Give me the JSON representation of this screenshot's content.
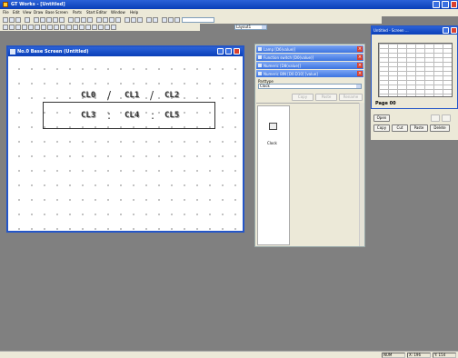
{
  "app": {
    "title": "GT Works - [Untitled]"
  },
  "menu": [
    "File",
    "Edit",
    "View",
    "Draw",
    "Base Screen",
    "Parts",
    "Start Editor",
    "Window",
    "Help"
  ],
  "toolbar": {
    "layer_value": "Layout1"
  },
  "base_window": {
    "title": "No.0 Base Screen (Untitled)",
    "clock_fields": {
      "cl0": "CL0",
      "cl1": "CL1",
      "cl2": "CL2",
      "cl3": "CL3",
      "cl4": "CL4",
      "cl5": "CL5"
    },
    "date_sep": "/",
    "time_sep": ":"
  },
  "parts_panel": {
    "processes": [
      {
        "label": "Lamp [D6(value)]"
      },
      {
        "label": "Function switch [D0(value)]"
      },
      {
        "label": "Numeric [D8(value)]"
      },
      {
        "label": "Numeric BIN [D0.D10] [value]"
      }
    ],
    "parttype_label": "Parttype",
    "parttype_value": "Clock",
    "buttons": {
      "copy": "Copy",
      "paste": "Paste",
      "rename": "Rename"
    },
    "part_item": "Clock"
  },
  "screen_window": {
    "title": "Untitled - Screen ...",
    "page_label": "Page 00",
    "buttons": {
      "open": "Open",
      "copy": "Copy",
      "cut": "Cut",
      "paste": "Paste",
      "delete": "Delete"
    }
  },
  "statusbar": {
    "mode": "NUM",
    "x": "X: 196",
    "y": "Y: 154"
  },
  "colors": {
    "titlebar": "#0a3fb8",
    "desktop": "#808080",
    "panel": "#ece9d8"
  }
}
